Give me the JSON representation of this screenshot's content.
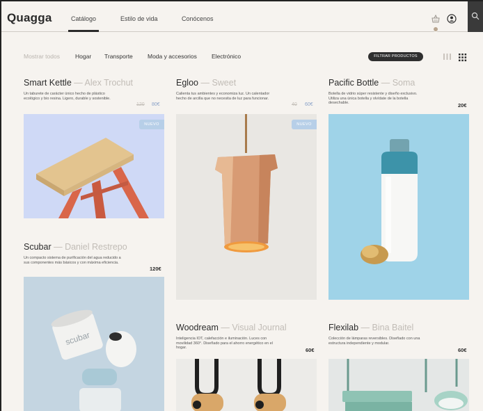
{
  "header": {
    "logo": "Quagga",
    "nav": [
      "Catálogo",
      "Estilo de vida",
      "Conócenos"
    ],
    "active_nav_index": 0,
    "icons": [
      "basket-icon",
      "user-icon",
      "search-icon"
    ]
  },
  "filters": {
    "show_all": "Mostrar todos",
    "categories": [
      "Hogar",
      "Transporte",
      "Moda y accesorios",
      "Electrónico"
    ],
    "filter_button": "FILTRAR PRODUCTOS"
  },
  "products": [
    {
      "name": "Smart Kettle",
      "sep": " — ",
      "brand": "Alex Trochut",
      "desc": "Un taburete de carácter único hecho de plástico ecológico y bio resina. Ligero, durable y sostenible.",
      "old_price": "120",
      "price": "80€",
      "badge": "NUEVO"
    },
    {
      "name": "Egloo",
      "sep": " — ",
      "brand": "Sweet",
      "desc": "Calienta tus ambientes y economiza luz. Un calentador hecho de arcilla que no necesita de luz para funcionar.",
      "old_price": "40",
      "price": "60€",
      "badge": "NUEVO"
    },
    {
      "name": "Pacific Bottle",
      "sep": " — ",
      "brand": "Soma",
      "desc": "Botella de vidrio súper resistente y diseño exclusivo. Utiliza una única botella y olvídate de la botella desechable.",
      "price": "20€"
    },
    {
      "name": "Scubar",
      "sep": " — ",
      "brand": "Daniel Restrepo",
      "desc": "Un compacto sistema de purificación del agua reducido a sus componentes más básicos y con máxima eficiencia.",
      "price": "120€"
    },
    {
      "name": "Woodream",
      "sep": " — ",
      "brand": "Visual Journal",
      "desc": "Inteligencia IOT, calefacción e iluminación. Luces con movilidad 360°. Diseñado para el ahorro energético en el hogar.",
      "price": "60€"
    },
    {
      "name": "Flexilab",
      "sep": " — ",
      "brand": "Bina Baitel",
      "desc": "Colección de lámparas reversibles. Diseñado con una estructura independiente y modular.",
      "price": "60€"
    }
  ],
  "colors": {
    "background": "#f6f3ef",
    "accent_blue": "#8aa2c8",
    "badge": "#b7cfe8",
    "muted": "#c1bcb6",
    "dark": "#2f2f2f"
  }
}
